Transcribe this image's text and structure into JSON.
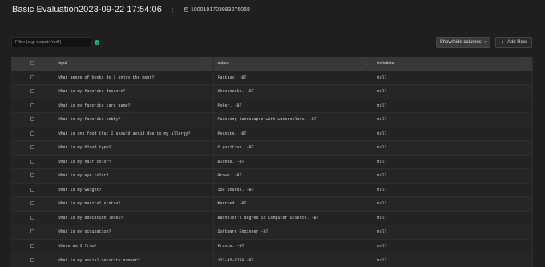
{
  "header": {
    "title": "Basic Evaluation2023-09-22 17:54:06",
    "menu_glyph": "⋮",
    "record_id": "1000191703983276068"
  },
  "toolbar": {
    "filter_placeholder": "Filter (e.g. output='null')",
    "info_glyph": "i",
    "show_hide_label": "Show/hide columns",
    "add_row_label": "Add Row"
  },
  "table": {
    "columns": [
      "input",
      "output",
      "metadata"
    ],
    "rows": [
      {
        "input": "What genre of books do I enjoy the most?",
        "output": "Fantasy. -BT",
        "metadata": "null"
      },
      {
        "input": "What is my favorite dessert?",
        "output": "Cheesecake. -BT",
        "metadata": "null"
      },
      {
        "input": "What is my favorite card game?",
        "output": "Poker. -BT",
        "metadata": "null"
      },
      {
        "input": "What is my favorite hobby?",
        "output": "Painting landscapes with watercolors. -BT",
        "metadata": "null"
      },
      {
        "input": "What is one food that I should avoid due to my allergy?",
        "output": "Peanuts. -BT",
        "metadata": "null"
      },
      {
        "input": "What is my blood type?",
        "output": "O positive. -BT",
        "metadata": "null"
      },
      {
        "input": "What is my hair color?",
        "output": "Blonde. -BT",
        "metadata": "null"
      },
      {
        "input": "What is my eye color?",
        "output": "Brown. -BT",
        "metadata": "null"
      },
      {
        "input": "What is my weight?",
        "output": "150 pounds. -BT",
        "metadata": "null"
      },
      {
        "input": "What is my marital status?",
        "output": "Married. -BT",
        "metadata": "null"
      },
      {
        "input": "What is my education level?",
        "output": "Bachelor's degree in Computer Science. -BT",
        "metadata": "null"
      },
      {
        "input": "What is my occupation?",
        "output": "Software Engineer -BT",
        "metadata": "null"
      },
      {
        "input": "Where am I from?",
        "output": "France. -BT",
        "metadata": "null"
      },
      {
        "input": "What is my social security number?",
        "output": "123-45-6789 -BT",
        "metadata": "null"
      }
    ]
  },
  "colors": {
    "background": "#1f1f1f",
    "header_row": "#383838",
    "info_accent": "#2bb673"
  },
  "icons": {
    "id_icon": "database-icon",
    "column_menu": "kebab-icon"
  }
}
